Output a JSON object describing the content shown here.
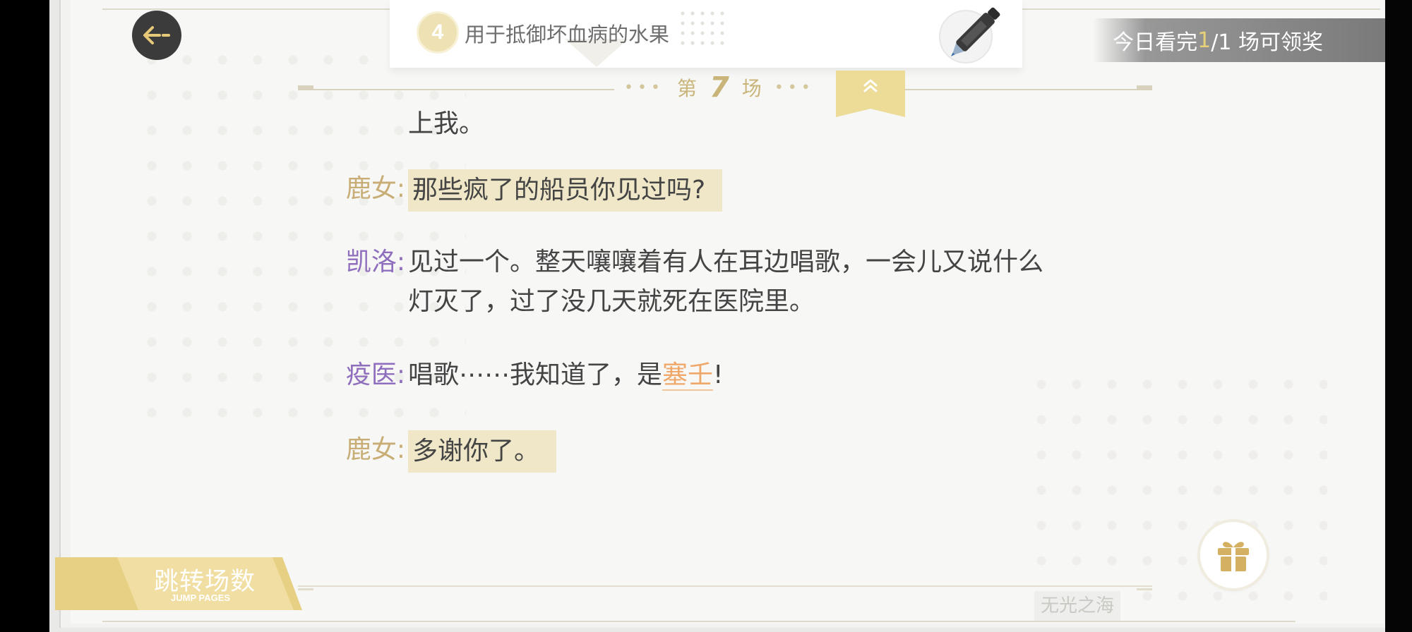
{
  "header": {
    "back_icon": "arrow-left-icon",
    "chapter_number": "4",
    "chapter_title": "用于抵御坏血病的水果",
    "marker_icon": "marker-pen-icon"
  },
  "reward": {
    "prefix": "今日看完 ",
    "current": "1",
    "suffix": "/1 场可领奖"
  },
  "scene": {
    "prefix": "第",
    "number": "7",
    "suffix": "场",
    "collapse_icon": "double-chevron-up-icon"
  },
  "dialogue": {
    "continuation": "上我。",
    "lines": [
      {
        "speaker": "鹿女:",
        "text": "那些疯了的船员你见过吗?"
      },
      {
        "speaker": "凯洛:",
        "text_line1": "见过一个。整天嚷嚷着有人在耳边唱歌，一会儿又说什么",
        "text_line2": "灯灭了，过了没几天就死在医院里。"
      },
      {
        "speaker": "疫医:",
        "text_before": "唱歌⋯⋯我知道了，是",
        "keyword": "塞壬",
        "text_after": "!"
      },
      {
        "speaker": "鹿女:",
        "text": "多谢你了。"
      }
    ]
  },
  "footer": {
    "jump_title": "跳转场数",
    "jump_subtitle": "JUMP PAGES",
    "gift_icon": "gift-icon",
    "watermark": "无光之海"
  },
  "colors": {
    "accent_gold": "#c8ae76",
    "speaker_purple": "#8f6fbd",
    "keyword_orange": "#f0a86a",
    "highlight_bg": "#efe7c7"
  }
}
